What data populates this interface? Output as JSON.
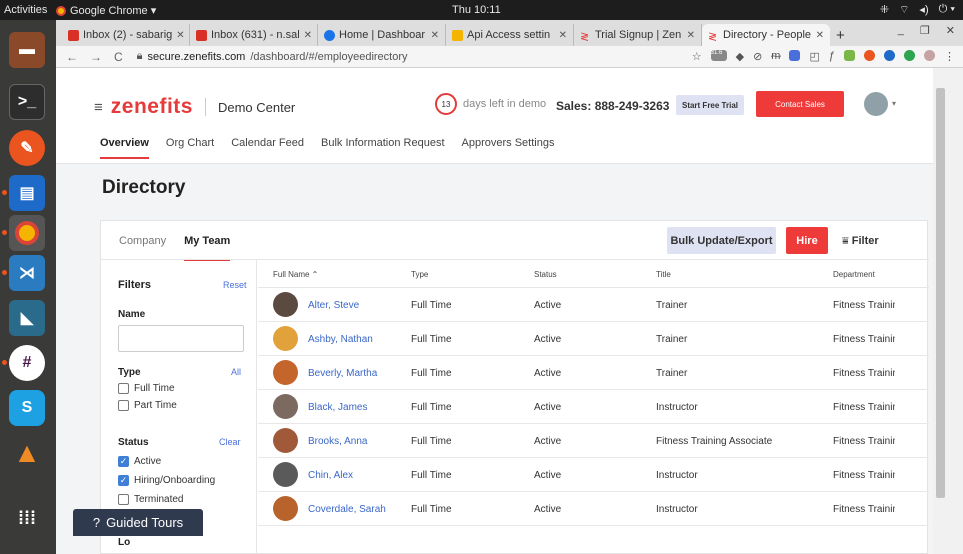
{
  "os": {
    "activities": "Activities",
    "app_name": "Google Chrome ▾",
    "clock": "Thu 10:11"
  },
  "browser": {
    "tabs": [
      {
        "label": "Inbox (2) - sabarig",
        "icon_color": "#d93025"
      },
      {
        "label": "Inbox (631) - n.sal",
        "icon_color": "#d93025"
      },
      {
        "label": "Home | Dashboar",
        "icon_color": "#1a73e8"
      },
      {
        "label": "Api Access settin",
        "icon_color": "#f4b400"
      },
      {
        "label": "Trial Signup | Zen",
        "icon_color": "#e53b3b"
      },
      {
        "label": "Directory - People",
        "icon_color": "#e53b3b"
      }
    ],
    "new_tab": "+",
    "url_host": "secure.zenefits.com",
    "url_path": "/dashboard/#/employeedirectory",
    "ext_badge": "31.6"
  },
  "header": {
    "brand": "zenefits",
    "demo": "Demo Center",
    "days_left_num": "13",
    "days_left_text": "days left in demo",
    "sales": "Sales: 888-249-3263",
    "start_trial": "Start Free Trial",
    "contact_sales": "Contact Sales"
  },
  "subnav": [
    "Overview",
    "Org Chart",
    "Calendar Feed",
    "Bulk Information Request",
    "Approvers Settings"
  ],
  "page_title": "Directory",
  "card": {
    "tabs": [
      "Company",
      "My Team"
    ],
    "bulk": "Bulk Update/Export",
    "hire": "Hire",
    "filter": "Filter"
  },
  "filters": {
    "title": "Filters",
    "reset": "Reset",
    "name_label": "Name",
    "type_label": "Type",
    "type_link": "All",
    "type_options": [
      {
        "label": "Full Time",
        "checked": false
      },
      {
        "label": "Part Time",
        "checked": false
      }
    ],
    "status_label": "Status",
    "status_link": "Clear",
    "status_options": [
      {
        "label": "Active",
        "checked": true
      },
      {
        "label": "Hiring/Onboarding",
        "checked": true
      },
      {
        "label": "Terminated",
        "checked": false
      }
    ],
    "next_label": "Lo"
  },
  "guided_tours": "Guided Tours",
  "table": {
    "columns": [
      "Full Name ⌃",
      "Type",
      "Status",
      "Title",
      "Department"
    ],
    "rows": [
      {
        "name": "Alter, Steve",
        "type": "Full Time",
        "status": "Active",
        "title": "Trainer",
        "department": "Fitness Training",
        "avatar": "#5b4a3f"
      },
      {
        "name": "Ashby, Nathan",
        "type": "Full Time",
        "status": "Active",
        "title": "Trainer",
        "department": "Fitness Training",
        "avatar": "#e2a23b"
      },
      {
        "name": "Beverly, Martha",
        "type": "Full Time",
        "status": "Active",
        "title": "Trainer",
        "department": "Fitness Training",
        "avatar": "#c4662c"
      },
      {
        "name": "Black, James",
        "type": "Full Time",
        "status": "Active",
        "title": "Instructor",
        "department": "Fitness Training",
        "avatar": "#7c6a60"
      },
      {
        "name": "Brooks, Anna",
        "type": "Full Time",
        "status": "Active",
        "title": "Fitness Training Associate",
        "department": "Fitness Training",
        "avatar": "#a05a3a"
      },
      {
        "name": "Chin, Alex",
        "type": "Full Time",
        "status": "Active",
        "title": "Instructor",
        "department": "Fitness Training",
        "avatar": "#5a5a5a"
      },
      {
        "name": "Coverdale, Sarah",
        "type": "Full Time",
        "status": "Active",
        "title": "Instructor",
        "department": "Fitness Training",
        "avatar": "#b8632b"
      }
    ]
  }
}
